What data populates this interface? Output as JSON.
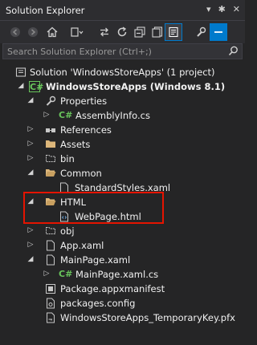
{
  "window": {
    "title": "Solution Explorer",
    "controls": [
      "▾",
      "✱",
      "✕"
    ]
  },
  "search": {
    "placeholder": "Search Solution Explorer (Ctrl+;)"
  },
  "tree": [
    {
      "label": "Solution 'WindowsStoreApps' (1 project)",
      "icon": "solution-icon",
      "expanded": null
    },
    {
      "label": "WindowsStoreApps (Windows 8.1)",
      "icon": "csharp-project-icon",
      "expanded": true,
      "bold": true
    },
    {
      "label": "Properties",
      "icon": "wrench-icon",
      "expanded": true
    },
    {
      "label": "AssemblyInfo.cs",
      "icon": "csharp-file-icon",
      "expanded": false
    },
    {
      "label": "References",
      "icon": "references-icon",
      "expanded": false
    },
    {
      "label": "Assets",
      "icon": "folder-icon",
      "expanded": false
    },
    {
      "label": "bin",
      "icon": "folder-outline-icon",
      "expanded": false
    },
    {
      "label": "Common",
      "icon": "folder-icon",
      "expanded": true
    },
    {
      "label": "StandardStyles.xaml",
      "icon": "xaml-file-icon",
      "expanded": null
    },
    {
      "label": "HTML",
      "icon": "folder-icon",
      "expanded": true
    },
    {
      "label": "WebPage.html",
      "icon": "html-file-icon",
      "expanded": null
    },
    {
      "label": "obj",
      "icon": "folder-outline-icon",
      "expanded": false
    },
    {
      "label": "App.xaml",
      "icon": "xaml-file-icon",
      "expanded": false
    },
    {
      "label": "MainPage.xaml",
      "icon": "xaml-file-icon",
      "expanded": true
    },
    {
      "label": "MainPage.xaml.cs",
      "icon": "csharp-file-icon",
      "expanded": false
    },
    {
      "label": "Package.appxmanifest",
      "icon": "manifest-file-icon",
      "expanded": null
    },
    {
      "label": "packages.config",
      "icon": "config-file-icon",
      "expanded": null
    },
    {
      "label": "WindowsStoreApps_TemporaryKey.pfx",
      "icon": "key-file-icon",
      "expanded": null
    }
  ],
  "colors": {
    "background": "#252526",
    "highlight_border": "#e51400",
    "accent": "#007acc"
  }
}
